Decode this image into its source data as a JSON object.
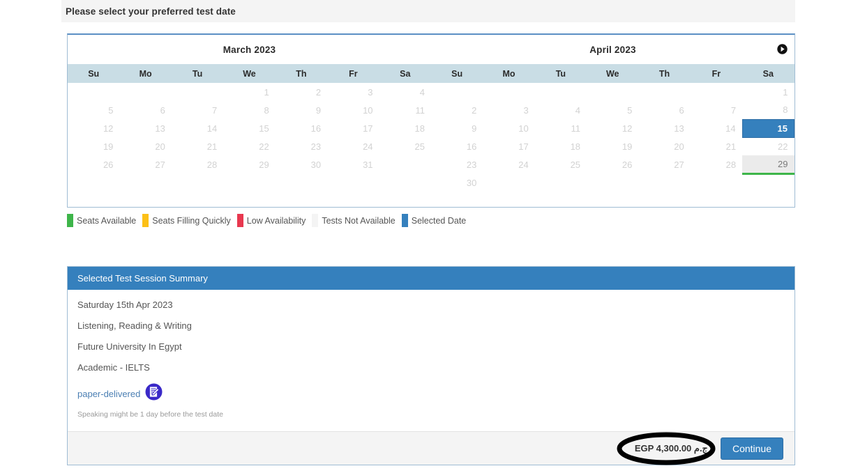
{
  "header": {
    "instruction": "Please select your preferred test date"
  },
  "calendar": {
    "next_month_icon": "next-month-arrow-icon",
    "weekday_headers": [
      "Su",
      "Mo",
      "Tu",
      "We",
      "Th",
      "Fr",
      "Sa"
    ],
    "months": [
      {
        "title": "March 2023",
        "weeks": [
          [
            "",
            "",
            "",
            "1",
            "2",
            "3",
            "4"
          ],
          [
            "5",
            "6",
            "7",
            "8",
            "9",
            "10",
            "11"
          ],
          [
            "12",
            "13",
            "14",
            "15",
            "16",
            "17",
            "18"
          ],
          [
            "19",
            "20",
            "21",
            "22",
            "23",
            "24",
            "25"
          ],
          [
            "26",
            "27",
            "28",
            "29",
            "30",
            "31",
            ""
          ],
          [
            "",
            "",
            "",
            "",
            "",
            "",
            ""
          ]
        ],
        "states": [
          [
            "empty",
            "empty",
            "empty",
            "na",
            "na",
            "na",
            "na"
          ],
          [
            "na",
            "na",
            "na",
            "na",
            "na",
            "na",
            "na"
          ],
          [
            "na",
            "na",
            "na",
            "na",
            "na",
            "na",
            "na"
          ],
          [
            "na",
            "na",
            "na",
            "na",
            "na",
            "na",
            "na"
          ],
          [
            "na",
            "na",
            "na",
            "na",
            "na",
            "na",
            "empty"
          ],
          [
            "empty",
            "empty",
            "empty",
            "empty",
            "empty",
            "empty",
            "empty"
          ]
        ]
      },
      {
        "title": "April 2023",
        "weeks": [
          [
            "",
            "",
            "",
            "",
            "",
            "",
            "1"
          ],
          [
            "2",
            "3",
            "4",
            "5",
            "6",
            "7",
            "8"
          ],
          [
            "9",
            "10",
            "11",
            "12",
            "13",
            "14",
            "15"
          ],
          [
            "16",
            "17",
            "18",
            "19",
            "20",
            "21",
            "22"
          ],
          [
            "23",
            "24",
            "25",
            "26",
            "27",
            "28",
            "29"
          ],
          [
            "30",
            "",
            "",
            "",
            "",
            "",
            ""
          ]
        ],
        "states": [
          [
            "empty",
            "empty",
            "empty",
            "empty",
            "empty",
            "empty",
            "na"
          ],
          [
            "na",
            "na",
            "na",
            "na",
            "na",
            "na",
            "na"
          ],
          [
            "na",
            "na",
            "na",
            "na",
            "na",
            "na",
            "sel"
          ],
          [
            "na",
            "na",
            "na",
            "na",
            "na",
            "na",
            "na"
          ],
          [
            "na",
            "na",
            "na",
            "na",
            "na",
            "na",
            "avail"
          ],
          [
            "na",
            "empty",
            "empty",
            "empty",
            "empty",
            "empty",
            "empty"
          ]
        ]
      }
    ]
  },
  "legend": {
    "items": [
      {
        "label": "Seats Available",
        "color": "#3eb54a"
      },
      {
        "label": "Seats Filling Quickly",
        "color": "#fcc017"
      },
      {
        "label": "Low Availability",
        "color": "#e8384f"
      },
      {
        "label": "Tests Not Available",
        "color": "#f4f4f4"
      },
      {
        "label": "Selected Date",
        "color": "#3580bd"
      }
    ]
  },
  "summary": {
    "title": "Selected Test Session Summary",
    "date": "Saturday 15th Apr 2023",
    "components": "Listening, Reading & Writing",
    "venue": "Future University In Egypt",
    "test_type": "Academic - IELTS",
    "delivery_mode": "paper-delivered",
    "delivery_icon": "paper-delivered-icon",
    "note": "Speaking might be 1 day before the test date",
    "price": "EGP 4,300.00 ج.م",
    "continue_label": "Continue"
  },
  "annotation": {
    "shape": "ellipse-highlight",
    "color": "#000000"
  }
}
